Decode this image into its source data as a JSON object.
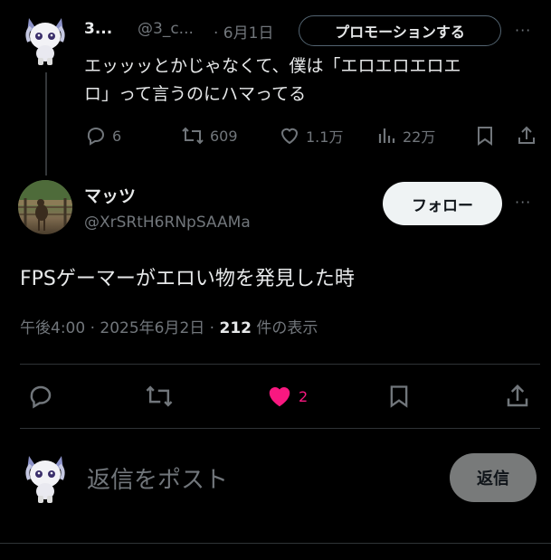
{
  "parent_tweet": {
    "author_name": "3...",
    "handle": "@3_c...",
    "date": "· 6月1日",
    "promote_label": "プロモーションする",
    "more_label": "···",
    "text_line1": "エッッッとかじゃなくて、僕は「エロエロエロエ",
    "text_line2": "ロ」って言うのにハマってる",
    "stats": {
      "replies": "6",
      "reposts": "609",
      "likes": "1.1万",
      "views": "22万"
    }
  },
  "main_tweet": {
    "author_name": "マッツ",
    "handle": "@XrSRtH6RNpSAAMa",
    "follow_label": "フォロー",
    "more_label": "···",
    "text": "FPSゲーマーがエロい物を発見した時",
    "time": "午後4:00 · 2025年6月2日 · ",
    "views_count": "212",
    "views_suffix": " 件の表示",
    "likes": "2",
    "like_color": "#f91880"
  },
  "reply_box": {
    "placeholder": "返信をポスト",
    "button_label": "返信"
  }
}
